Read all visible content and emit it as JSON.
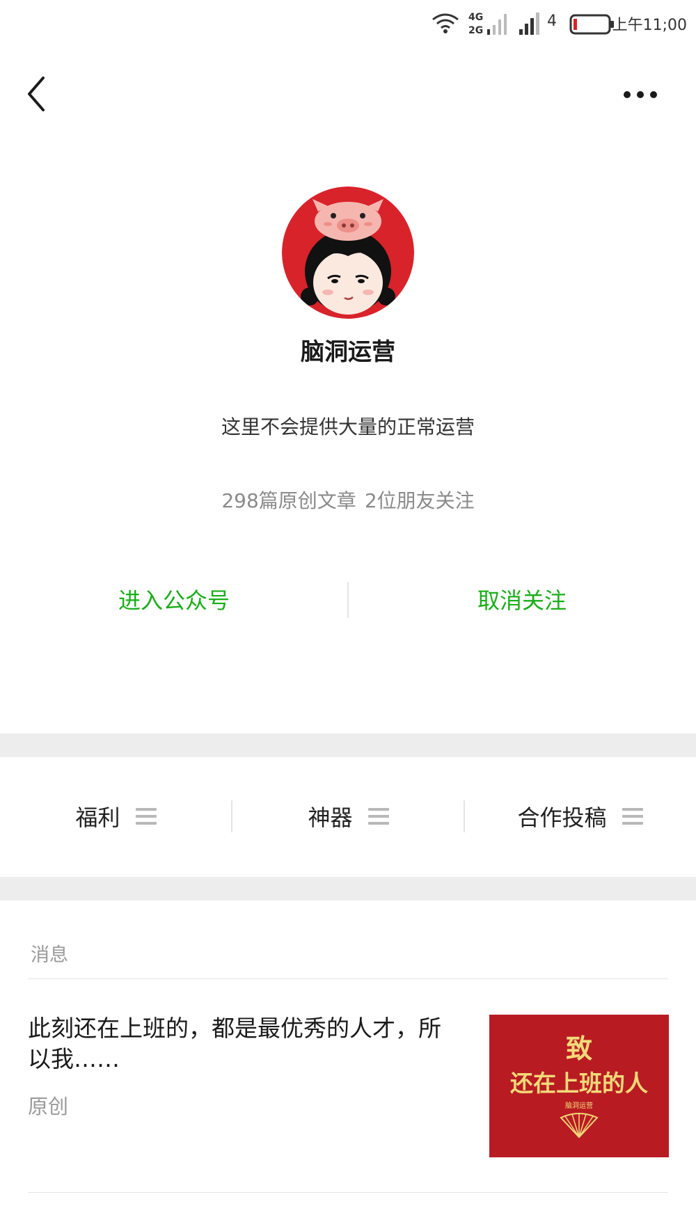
{
  "status_bar": {
    "net_top": "4G",
    "net_bottom": "2G",
    "sim_number": "4",
    "time": "上午11;00"
  },
  "nav": {
    "back_icon": "chevron-left-icon",
    "more_icon": "more-horizontal-icon"
  },
  "profile": {
    "name": "脑洞运营",
    "description": "这里不会提供大量的正常运营",
    "articles_count": "298篇原创文章",
    "friends_following": "2位朋友关注"
  },
  "actions": {
    "enter": "进入公众号",
    "unfollow": "取消关注"
  },
  "menu": {
    "items": [
      {
        "label": "福利",
        "icon": "menu-lines-icon"
      },
      {
        "label": "神器",
        "icon": "menu-lines-icon"
      },
      {
        "label": "合作投稿",
        "icon": "menu-lines-icon"
      }
    ]
  },
  "messages": {
    "section_label": "消息",
    "items": [
      {
        "title": "此刻还在上班的，都是最优秀的人才，所以我……",
        "tag": "原创",
        "thumbnail": {
          "line1": "致",
          "line2": "还在上班的人",
          "line3": "脑洞运营"
        }
      }
    ]
  },
  "colors": {
    "accent_green": "#1aad19",
    "avatar_red": "#d8232a",
    "thumbnail_red": "#b81c22",
    "separator_band": "#ededed"
  }
}
